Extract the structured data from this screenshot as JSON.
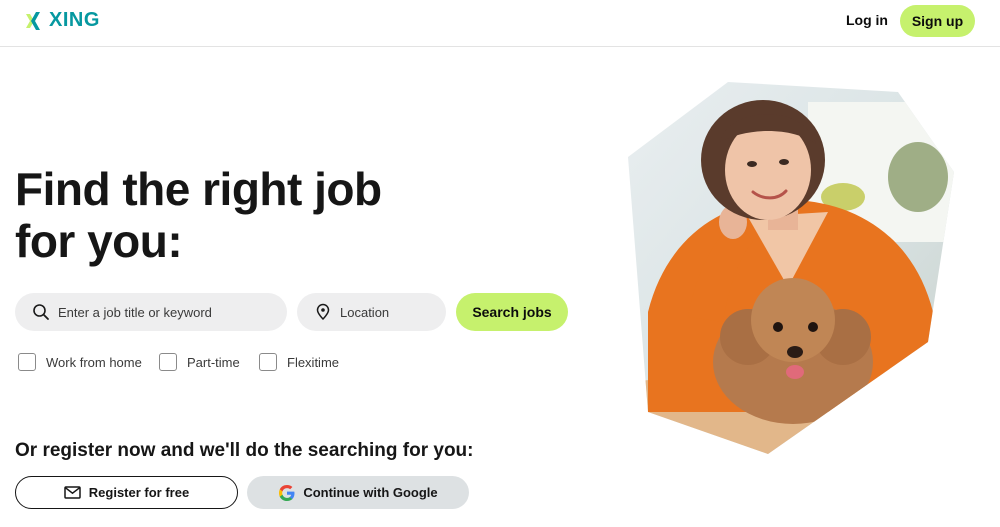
{
  "header": {
    "brand": "XING",
    "login_label": "Log in",
    "signup_label": "Sign up"
  },
  "hero": {
    "title_line1": "Find the right job",
    "title_line2": "for you:",
    "search": {
      "keyword_placeholder": "Enter a job title or keyword",
      "location_placeholder": "Location",
      "button_label": "Search jobs"
    },
    "filters": [
      {
        "label": "Work from home",
        "checked": false
      },
      {
        "label": "Part-time",
        "checked": false
      },
      {
        "label": "Flexitime",
        "checked": false
      }
    ],
    "register_heading": "Or register now and we'll do the searching for you:",
    "register_button": "Register for free",
    "google_button": "Continue with Google"
  },
  "icons": {
    "search": "search-icon",
    "location": "location-pin-icon",
    "mail": "mail-icon",
    "google": "google-icon"
  },
  "colors": {
    "brand_teal": "#0698a0",
    "brand_green": "#c6f16d",
    "field_bg": "#eeeeef",
    "google_btn_bg": "#dde1e3"
  }
}
